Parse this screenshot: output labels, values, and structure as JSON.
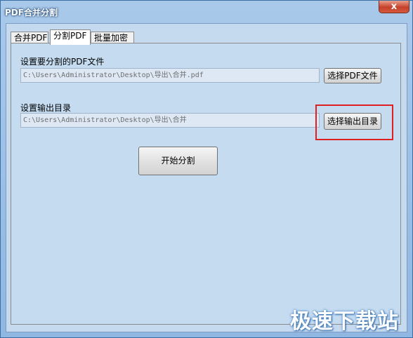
{
  "window": {
    "title": "PDF合并分割",
    "close_glyph": "x"
  },
  "tabs": [
    {
      "label": "合并PDF",
      "active": false
    },
    {
      "label": "分割PDF",
      "active": true
    },
    {
      "label": "批量加密",
      "active": false
    }
  ],
  "split": {
    "pdf_file_label": "设置要分割的PDF文件",
    "pdf_file_value": "C:\\Users\\Administrator\\Desktop\\导出\\合并.pdf",
    "choose_pdf_button": "选择PDF文件",
    "output_dir_label": "设置输出目录",
    "output_dir_value": "C:\\Users\\Administrator\\Desktop\\导出\\合并",
    "choose_output_button": "选择输出目录",
    "start_button": "开始分割"
  },
  "watermark": "极速下载站",
  "colors": {
    "highlight": "#e02020",
    "close_button": "#c6412b"
  }
}
